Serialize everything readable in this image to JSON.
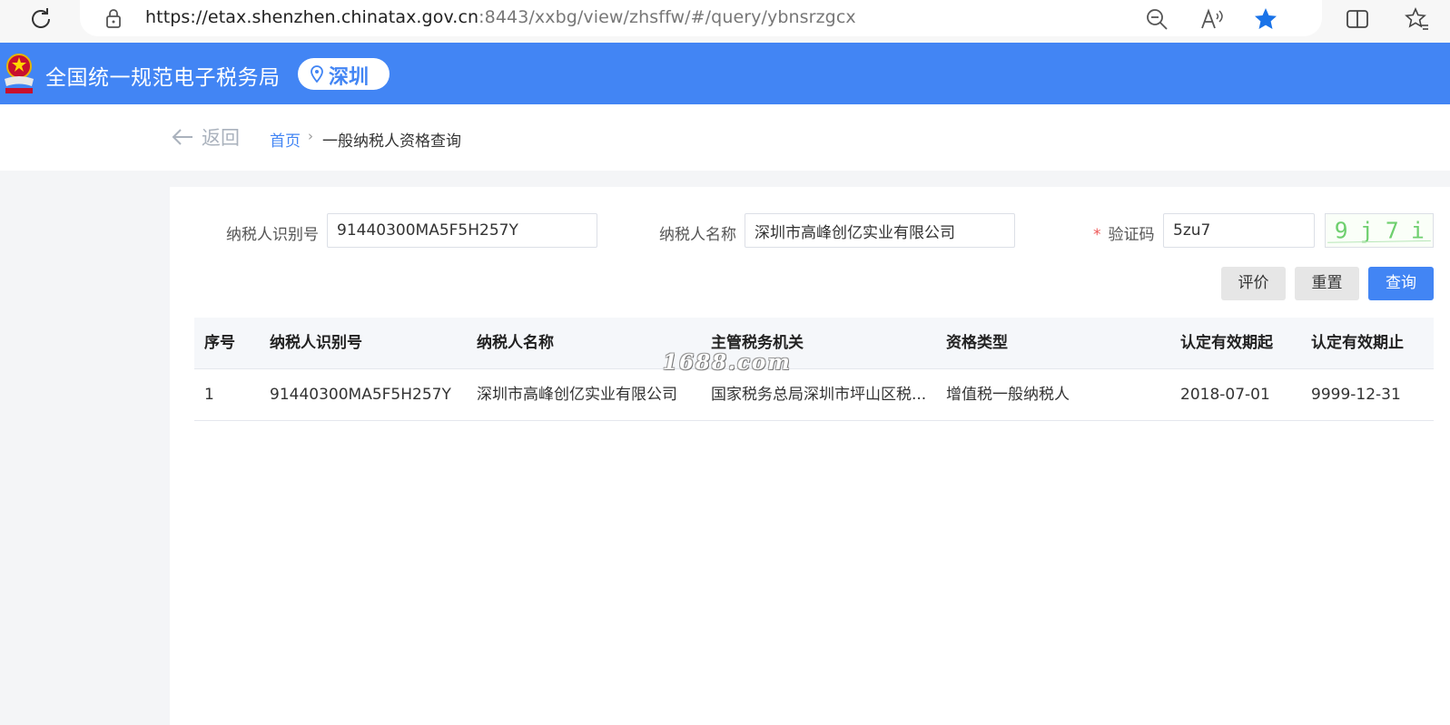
{
  "browser": {
    "url_main": "https://etax.shenzhen.chinatax.gov.cn",
    "url_rest": ":8443/xxbg/view/zhsffw/#/query/ybnsrzgcx"
  },
  "header": {
    "title": "全国统一规范电子税务局",
    "city": "深圳"
  },
  "breadcrumb": {
    "back": "返回",
    "home": "首页",
    "separator": "›",
    "current": "一般纳税人资格查询"
  },
  "form": {
    "taxpayer_id_label": "纳税人识别号",
    "taxpayer_id_value": "91440300MA5F5H257Y",
    "taxpayer_name_label": "纳税人名称",
    "taxpayer_name_value": "深圳市高峰创亿实业有限公司",
    "captcha_required_mark": "*",
    "captcha_label": "验证码",
    "captcha_value": "5zu7",
    "captcha_image_text": "9j7i"
  },
  "buttons": {
    "evaluate": "评价",
    "reset": "重置",
    "query": "查询"
  },
  "table": {
    "headers": [
      "序号",
      "纳税人识别号",
      "纳税人名称",
      "主管税务机关",
      "资格类型",
      "认定有效期起",
      "认定有效期止"
    ],
    "rows": [
      [
        "1",
        "91440300MA5F5H257Y",
        "深圳市高峰创亿实业有限公司",
        "国家税务总局深圳市坪山区税...",
        "增值税一般纳税人",
        "2018-07-01",
        "9999-12-31"
      ]
    ]
  },
  "watermark": "1688.com",
  "colors": {
    "brand_blue": "#4285f4",
    "page_bg": "#f4f5f7"
  }
}
